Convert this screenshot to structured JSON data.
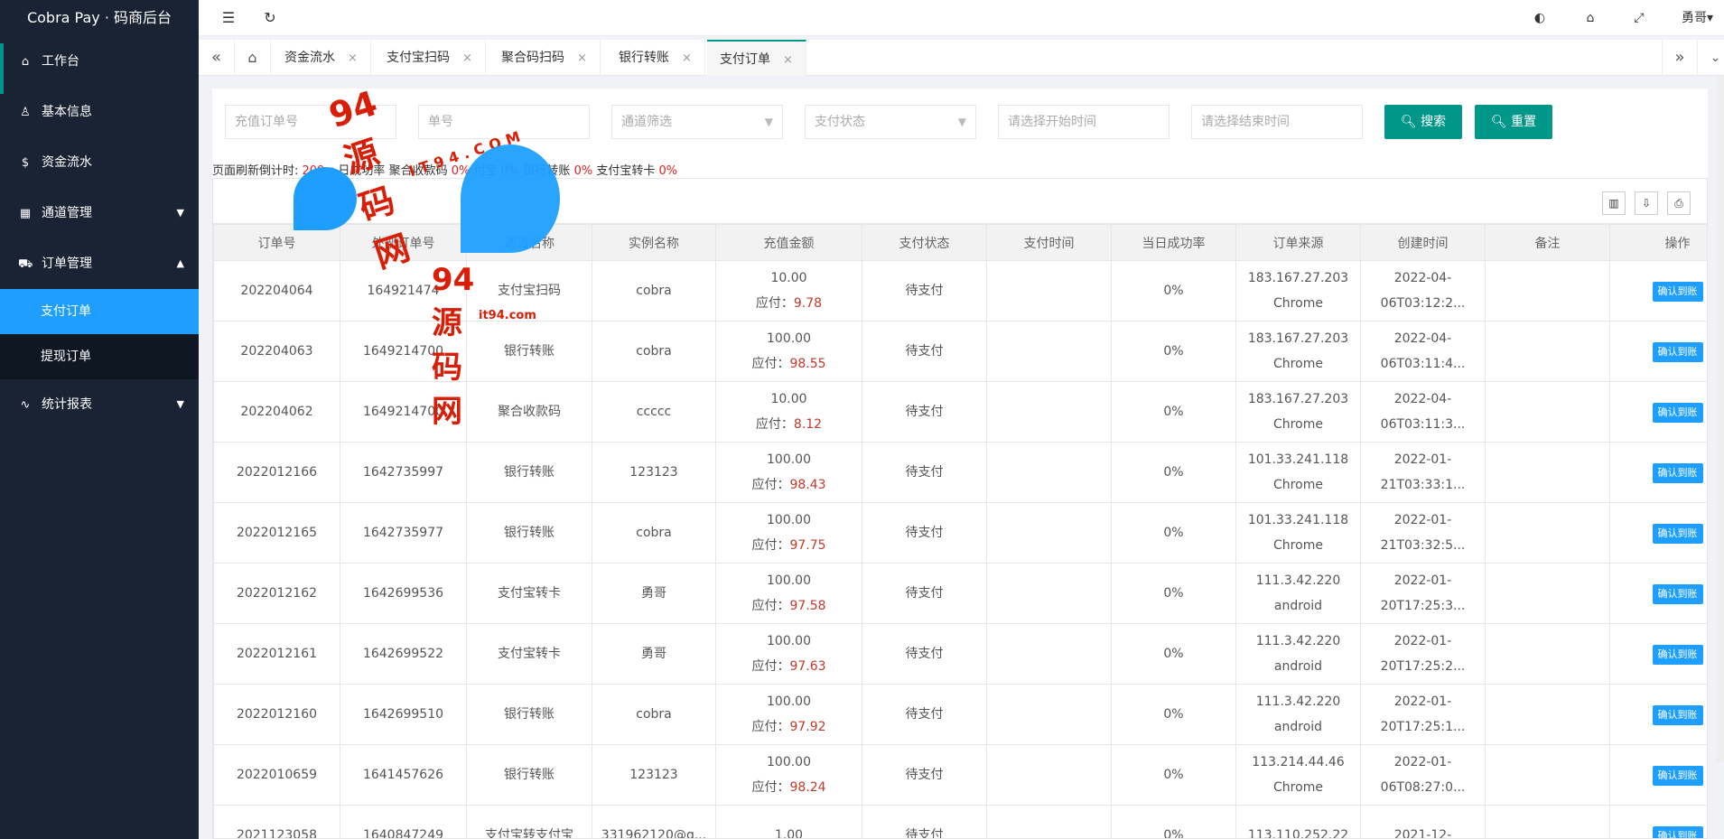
{
  "app": {
    "title": "Cobra Pay · 码商后台"
  },
  "sidebar": {
    "items": [
      {
        "label": "工作台",
        "icon": "home-icon"
      },
      {
        "label": "基本信息",
        "icon": "user-icon"
      },
      {
        "label": "资金流水",
        "icon": "money-icon"
      },
      {
        "label": "通道管理",
        "icon": "channel-icon",
        "arrow": "▼"
      },
      {
        "label": "订单管理",
        "icon": "cart-icon",
        "arrow": "▲"
      },
      {
        "label": "统计报表",
        "icon": "chart-icon",
        "arrow": "▼"
      }
    ],
    "sub_items": [
      {
        "label": "支付订单"
      },
      {
        "label": "提现订单"
      }
    ]
  },
  "topbar": {
    "user": "勇哥",
    "user_arrow": "▾"
  },
  "tabs": [
    {
      "label": "资金流水"
    },
    {
      "label": "支付宝扫码"
    },
    {
      "label": "聚合码扫码"
    },
    {
      "label": "银行转账"
    },
    {
      "label": "支付订单"
    }
  ],
  "search": {
    "order_no_placeholder": "充值订单号",
    "ext_order_placeholder": "单号",
    "channel_placeholder": "通道筛选",
    "status_placeholder": "支付状态",
    "start_time_placeholder": "请选择开始时间",
    "end_time_placeholder": "请选择结束时间",
    "search_label": "搜索",
    "reset_label": "重置"
  },
  "stats": {
    "refresh_prefix": "页面刷新倒计时:",
    "countdown": "209",
    "unit": "s",
    "today_label": "日成功率",
    "aggregate_label": "聚合收款码",
    "aggregate_value": "0%",
    "alipay_label": "付宝",
    "alipay_value": "0%",
    "bank_label": "银行转账",
    "bank_value": "0%",
    "alicard_label": "支付宝转卡",
    "alicard_value": "0%"
  },
  "table": {
    "headers": [
      "订单号",
      "外部订单号",
      "通道名称",
      "实例名称",
      "充值金额",
      "支付状态",
      "支付时间",
      "当日成功率",
      "订单来源",
      "创建时间",
      "备注",
      "操作"
    ],
    "pay_label": "应付：",
    "action_label": "确认到账",
    "rows": [
      {
        "order": "202204064",
        "ext": "164921474",
        "channel": "支付宝扫码",
        "instance": "cobra",
        "amount": "10.00",
        "pay": "9.78",
        "status": "待支付",
        "paytime": "",
        "rate": "0%",
        "ip": "183.167.27.203",
        "ua": "Chrome",
        "c1": "2022-04-",
        "c2": "06T03:12:2...",
        "note": ""
      },
      {
        "order": "202204063",
        "ext": "1649214700",
        "channel": "银行转账",
        "instance": "cobra",
        "amount": "100.00",
        "pay": "98.55",
        "status": "待支付",
        "paytime": "",
        "rate": "0%",
        "ip": "183.167.27.203",
        "ua": "Chrome",
        "c1": "2022-04-",
        "c2": "06T03:11:4...",
        "note": ""
      },
      {
        "order": "202204062",
        "ext": "1649214700",
        "channel": "聚合收款码",
        "instance": "ccccc",
        "amount": "10.00",
        "pay": "8.12",
        "status": "待支付",
        "paytime": "",
        "rate": "0%",
        "ip": "183.167.27.203",
        "ua": "Chrome",
        "c1": "2022-04-",
        "c2": "06T03:11:3...",
        "note": ""
      },
      {
        "order": "2022012166",
        "ext": "1642735997",
        "channel": "银行转账",
        "instance": "123123",
        "amount": "100.00",
        "pay": "98.43",
        "status": "待支付",
        "paytime": "",
        "rate": "0%",
        "ip": "101.33.241.118",
        "ua": "Chrome",
        "c1": "2022-01-",
        "c2": "21T03:33:1...",
        "note": ""
      },
      {
        "order": "2022012165",
        "ext": "1642735977",
        "channel": "银行转账",
        "instance": "cobra",
        "amount": "100.00",
        "pay": "97.75",
        "status": "待支付",
        "paytime": "",
        "rate": "0%",
        "ip": "101.33.241.118",
        "ua": "Chrome",
        "c1": "2022-01-",
        "c2": "21T03:32:5...",
        "note": ""
      },
      {
        "order": "2022012162",
        "ext": "1642699536",
        "channel": "支付宝转卡",
        "instance": "勇哥",
        "amount": "100.00",
        "pay": "97.58",
        "status": "待支付",
        "paytime": "",
        "rate": "0%",
        "ip": "111.3.42.220",
        "ua": "android",
        "c1": "2022-01-",
        "c2": "20T17:25:3...",
        "note": ""
      },
      {
        "order": "2022012161",
        "ext": "1642699522",
        "channel": "支付宝转卡",
        "instance": "勇哥",
        "amount": "100.00",
        "pay": "97.63",
        "status": "待支付",
        "paytime": "",
        "rate": "0%",
        "ip": "111.3.42.220",
        "ua": "android",
        "c1": "2022-01-",
        "c2": "20T17:25:2...",
        "note": ""
      },
      {
        "order": "2022012160",
        "ext": "1642699510",
        "channel": "银行转账",
        "instance": "cobra",
        "amount": "100.00",
        "pay": "97.92",
        "status": "待支付",
        "paytime": "",
        "rate": "0%",
        "ip": "111.3.42.220",
        "ua": "android",
        "c1": "2022-01-",
        "c2": "20T17:25:1...",
        "note": ""
      },
      {
        "order": "2022010659",
        "ext": "1641457626",
        "channel": "银行转账",
        "instance": "123123",
        "amount": "100.00",
        "pay": "98.24",
        "status": "待支付",
        "paytime": "",
        "rate": "0%",
        "ip": "113.214.44.46",
        "ua": "Chrome",
        "c1": "2022-01-",
        "c2": "06T08:27:0...",
        "note": ""
      },
      {
        "order": "2021123058",
        "ext": "1640847249",
        "channel": "支付宝转支付宝",
        "instance": "331962120@q...",
        "amount": "1.00",
        "pay": "",
        "status": "待支付",
        "paytime": "",
        "rate": "0%",
        "ip": "113.110.252.22",
        "ua": "",
        "c1": "2021-12-",
        "c2": "",
        "note": ""
      }
    ]
  },
  "watermark": {
    "text1": "94源码网",
    "text2": "IT94.COM",
    "text3": "94源码网",
    "text4": "it94.com"
  },
  "colors": {
    "sidebar_bg": "#192333",
    "accent": "#009688",
    "active_blue": "#1e9fff",
    "pay_red": "#c0392b"
  }
}
